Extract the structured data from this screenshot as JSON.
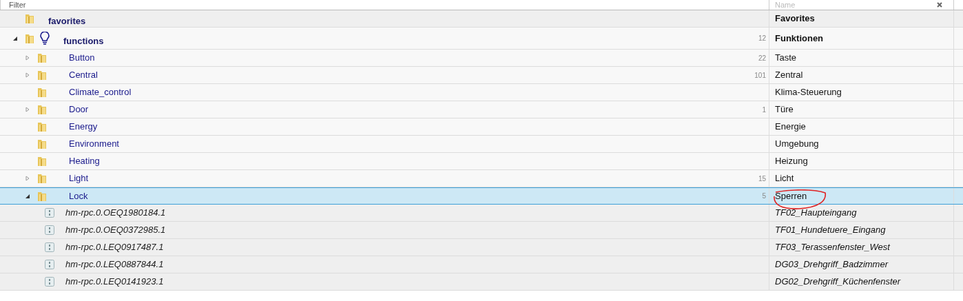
{
  "filters": {
    "id_placeholder": "Filter",
    "name_placeholder": "Name"
  },
  "tree": [
    {
      "kind": "folder",
      "id": "favorites",
      "name": "Favorites",
      "selected": false
    },
    {
      "kind": "folder",
      "id": "functions",
      "name": "Funktionen",
      "count": "12",
      "expanded": true,
      "selected": false,
      "children": [
        {
          "kind": "folder",
          "id": "Button",
          "name": "Taste",
          "count": "22",
          "expanded": false,
          "selected": false
        },
        {
          "kind": "folder",
          "id": "Central",
          "name": "Zentral",
          "count": "101",
          "expanded": false,
          "selected": false
        },
        {
          "kind": "folder",
          "id": "Climate_control",
          "name": "Klima-Steuerung",
          "selected": false
        },
        {
          "kind": "folder",
          "id": "Door",
          "name": "Türe",
          "count": "1",
          "expanded": false,
          "selected": false
        },
        {
          "kind": "folder",
          "id": "Energy",
          "name": "Energie",
          "selected": false
        },
        {
          "kind": "folder",
          "id": "Environment",
          "name": "Umgebung",
          "selected": false
        },
        {
          "kind": "folder",
          "id": "Heating",
          "name": "Heizung",
          "selected": false
        },
        {
          "kind": "folder",
          "id": "Light",
          "name": "Licht",
          "count": "15",
          "expanded": false,
          "selected": false
        },
        {
          "kind": "folder",
          "id": "Lock",
          "name": "Sperren",
          "count": "5",
          "expanded": true,
          "selected": true,
          "circled": true,
          "children": [
            {
              "kind": "channel",
              "id": "hm-rpc.0.OEQ1980184.1",
              "name": "TF02_Haupteingang",
              "selected": false
            },
            {
              "kind": "channel",
              "id": "hm-rpc.0.OEQ0372985.1",
              "name": "TF01_Hundetuere_Eingang",
              "selected": false
            },
            {
              "kind": "channel",
              "id": "hm-rpc.0.LEQ0917487.1",
              "name": "TF03_Terassenfenster_West",
              "selected": false
            },
            {
              "kind": "channel",
              "id": "hm-rpc.0.LEQ0887844.1",
              "name": "DG03_Drehgriff_Badzimmer",
              "selected": false
            },
            {
              "kind": "channel",
              "id": "hm-rpc.0.LEQ0141923.1",
              "name": "DG02_Drehgriff_Küchenfenster",
              "selected": false
            }
          ]
        }
      ]
    }
  ]
}
